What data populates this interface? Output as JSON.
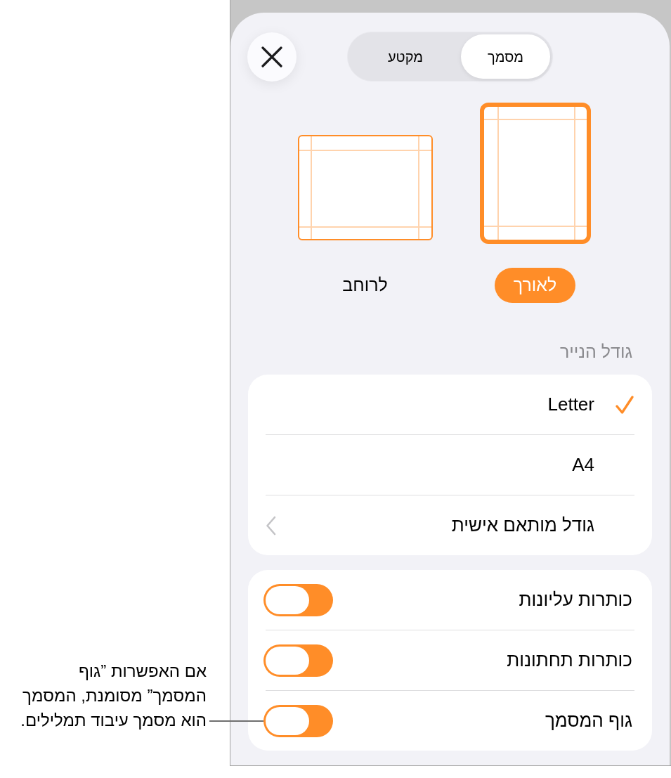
{
  "callout": {
    "lines": [
      "אם האפשרות ”גוף",
      "המסמך” מסומנת, המסמך",
      "הוא מסמך עיבוד תמלילים."
    ]
  },
  "segments": [
    {
      "label": "מסמך",
      "selected": true
    },
    {
      "label": "מקטע",
      "selected": false
    }
  ],
  "orientations": [
    {
      "label": "לאורך",
      "kind": "portrait",
      "selected": true
    },
    {
      "label": "לרוחב",
      "kind": "landscape",
      "selected": false
    }
  ],
  "paper_size": {
    "header": "גודל הנייר",
    "items": [
      {
        "label": "Letter",
        "kind": "option",
        "selected": true
      },
      {
        "label": "A4",
        "kind": "option",
        "selected": false
      },
      {
        "label": "גודל מותאם אישית",
        "kind": "link"
      }
    ]
  },
  "toggles": [
    {
      "label": "כותרות עליונות",
      "on": true
    },
    {
      "label": "כותרות תחתונות",
      "on": true
    },
    {
      "label": "גוף המסמך",
      "on": true
    }
  ]
}
